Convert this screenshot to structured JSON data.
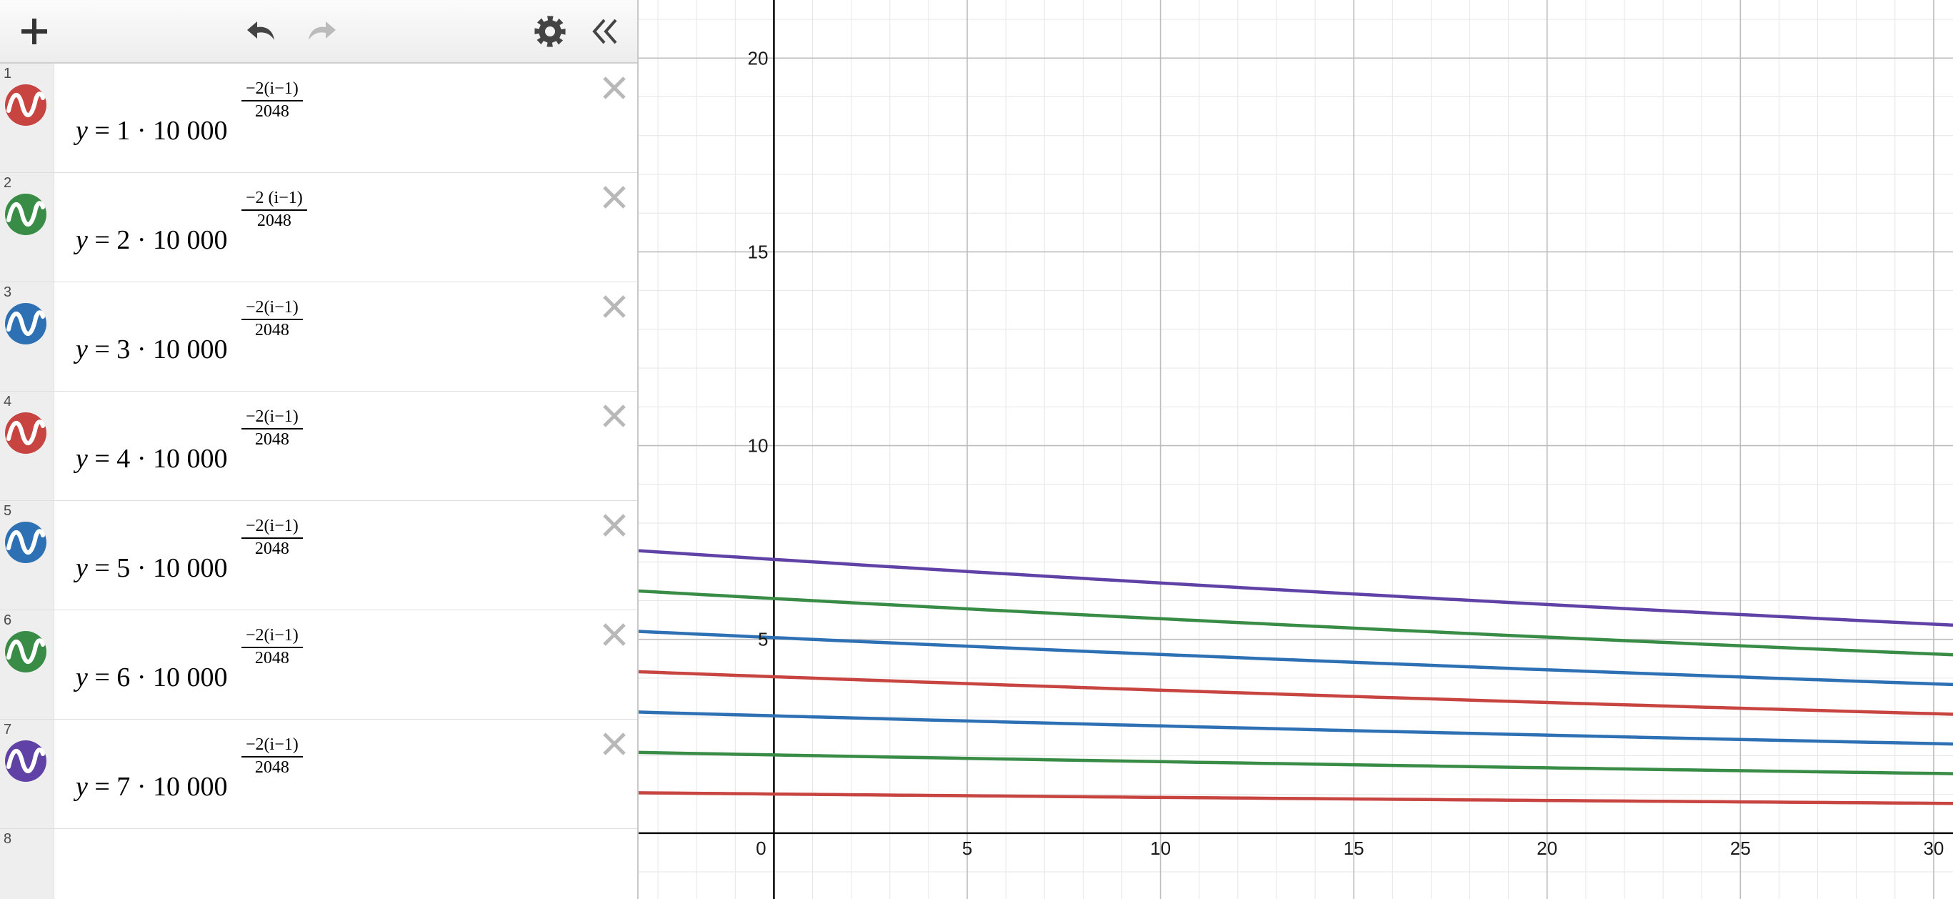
{
  "toolbar": {
    "add_icon": "plus-icon",
    "undo_icon": "undo-icon",
    "redo_icon": "redo-icon",
    "settings_icon": "gear-icon",
    "collapse_icon": "double-chevron-left-icon"
  },
  "expressions": [
    {
      "index": "1",
      "lhs": "y = 1 ",
      "dot": "· 10 000",
      "exp_num": "−2(i−1)",
      "exp_den": "2048",
      "color": "#c74440"
    },
    {
      "index": "2",
      "lhs": "y = 2",
      "dot": "· 10 000",
      "exp_num": "−2 (i−1)",
      "exp_den": "2048",
      "color": "#388c46"
    },
    {
      "index": "3",
      "lhs": "y = 3",
      "dot": "· 10 000",
      "exp_num": "−2(i−1)",
      "exp_den": "2048",
      "color": "#2d70b3"
    },
    {
      "index": "4",
      "lhs": "y = 4",
      "dot": "· 10 000",
      "exp_num": "−2(i−1)",
      "exp_den": "2048",
      "color": "#c74440"
    },
    {
      "index": "5",
      "lhs": "y = 5",
      "dot": "· 10 000",
      "exp_num": "−2(i−1)",
      "exp_den": "2048",
      "color": "#2d70b3"
    },
    {
      "index": "6",
      "lhs": "y = 6",
      "dot": "· 10 000",
      "exp_num": "−2(i−1)",
      "exp_den": "2048",
      "color": "#388c46"
    },
    {
      "index": "7",
      "lhs": "y = 7",
      "dot": "· 10 000",
      "exp_num": "−2(i−1)",
      "exp_den": "2048",
      "color": "#6042a6"
    }
  ],
  "empty_row_index": "8",
  "graph": {
    "x_range": [
      -3.5,
      30.5
    ],
    "y_range": [
      -1.7,
      21.5
    ],
    "major_step": 5,
    "minor_step": 1,
    "x_tick_labels": [
      "0",
      "5",
      "10",
      "15",
      "20",
      "25",
      "30"
    ],
    "y_tick_labels": [
      "5",
      "10",
      "15",
      "20"
    ],
    "curves": [
      {
        "coef": 1,
        "color": "#c74440"
      },
      {
        "coef": 2,
        "color": "#388c46"
      },
      {
        "coef": 3,
        "color": "#2d70b3"
      },
      {
        "coef": 4,
        "color": "#c74440"
      },
      {
        "coef": 5,
        "color": "#2d70b3"
      },
      {
        "coef": 6,
        "color": "#388c46"
      },
      {
        "coef": 7,
        "color": "#6042a6"
      }
    ],
    "base": 10000,
    "exp_num_coef": -2,
    "exp_den": 2048,
    "colors": {
      "major_grid": "#bdbdbd",
      "minor_grid": "#e6e6e6",
      "axis": "#000000"
    }
  }
}
